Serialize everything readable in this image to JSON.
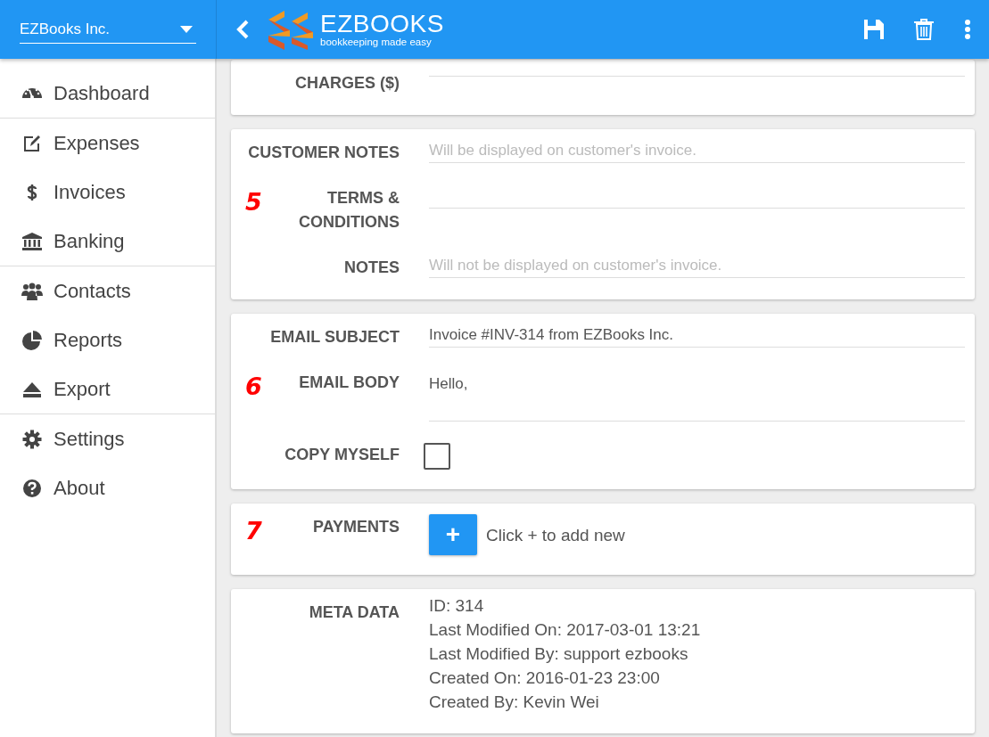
{
  "company_select": {
    "value": "EZBooks Inc."
  },
  "logo": {
    "name": "EZBOOKS",
    "tagline": "bookkeeping made easy"
  },
  "sidebar": {
    "groups": [
      {
        "items": [
          {
            "label": "Dashboard"
          }
        ]
      },
      {
        "items": [
          {
            "label": "Expenses"
          },
          {
            "label": "Invoices"
          },
          {
            "label": "Banking"
          }
        ]
      },
      {
        "items": [
          {
            "label": "Contacts"
          },
          {
            "label": "Reports"
          },
          {
            "label": "Export"
          }
        ]
      },
      {
        "items": [
          {
            "label": "Settings"
          },
          {
            "label": "About"
          }
        ]
      }
    ]
  },
  "cards": [
    {
      "rows": [
        {
          "kind": "line",
          "label": "CHARGES ($)"
        }
      ]
    },
    {
      "rows": [
        {
          "kind": "field",
          "label": "CUSTOMER NOTES",
          "placeholder": "Will be displayed on customer's invoice."
        },
        {
          "kind": "field",
          "label": "TERMS & CONDITIONS",
          "annotation": "5"
        },
        {
          "kind": "field",
          "label": "NOTES",
          "placeholder": "Will not be displayed on customer's invoice."
        }
      ]
    },
    {
      "rows": [
        {
          "kind": "field",
          "label": "EMAIL SUBJECT",
          "value": "Invoice #INV-314 from EZBooks Inc."
        },
        {
          "kind": "textarea",
          "label": "EMAIL BODY",
          "value": "Hello,",
          "annotation": "6"
        },
        {
          "kind": "checkbox",
          "label": "COPY MYSELF",
          "checked": false
        }
      ]
    },
    {
      "rows": [
        {
          "kind": "add",
          "label": "PAYMENTS",
          "button": "+",
          "hint": "Click + to add new",
          "annotation": "7"
        }
      ]
    },
    {
      "rows": [
        {
          "kind": "meta",
          "label": "META DATA",
          "lines": [
            "ID: 314",
            "Last Modified On: 2017-03-01 13:21",
            "Last Modified By: support ezbooks",
            "Created On: 2016-01-23 23:00",
            "Created By: Kevin Wei"
          ]
        }
      ]
    }
  ]
}
